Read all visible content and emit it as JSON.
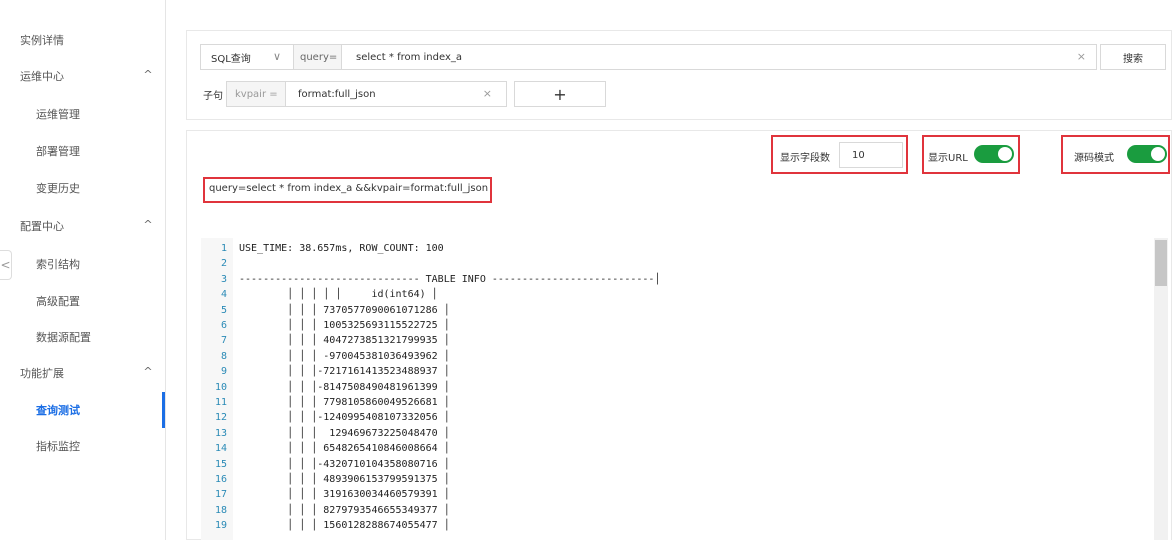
{
  "sidebar": {
    "items": [
      {
        "label": "实例详情",
        "level": "top"
      },
      {
        "label": "运维中心",
        "level": "top",
        "chevron": "^"
      },
      {
        "label": "运维管理",
        "level": "sub"
      },
      {
        "label": "部署管理",
        "level": "sub"
      },
      {
        "label": "变更历史",
        "level": "sub"
      },
      {
        "label": "配置中心",
        "level": "top",
        "chevron": "^"
      },
      {
        "label": "索引结构",
        "level": "sub"
      },
      {
        "label": "高级配置",
        "level": "sub"
      },
      {
        "label": "数据源配置",
        "level": "sub"
      },
      {
        "label": "功能扩展",
        "level": "top",
        "chevron": "^"
      },
      {
        "label": "查询测试",
        "level": "sub",
        "active": true
      },
      {
        "label": "指标监控",
        "level": "sub"
      }
    ],
    "collapse_glyph": "<"
  },
  "query": {
    "type_select": "SQL查询",
    "type_caret": "∨",
    "query_prefix": "query=",
    "query_value": "select * from   index_a",
    "clear_glyph": "×",
    "search_label": "搜索"
  },
  "clause": {
    "label": "子句",
    "key_select": "kvpair =",
    "value": "format:full_json",
    "clear_glyph": "×",
    "add_glyph": "+"
  },
  "options": {
    "field_count_label": "显示字段数",
    "field_count_value": "10",
    "show_url_label": "显示URL",
    "show_url_on": true,
    "source_mode_label": "源码模式",
    "source_mode_on": true
  },
  "url_text": "query=select * from index_a &&kvpair=format:full_json",
  "code_lines": [
    {
      "n": "1",
      "t": "USE_TIME: 38.657ms, ROW_COUNT: 100"
    },
    {
      "n": "2",
      "t": ""
    },
    {
      "n": "3",
      "t": "------------------------------ TABLE INFO ---------------------------│"
    },
    {
      "n": "4",
      "t": "        │ │ │ │ │     id(int64) │"
    },
    {
      "n": "5",
      "t": "        │ │ │ 7370577090061071286 │"
    },
    {
      "n": "6",
      "t": "        │ │ │ 1005325693115522725 │"
    },
    {
      "n": "7",
      "t": "        │ │ │ 4047273851321799935 │"
    },
    {
      "n": "8",
      "t": "        │ │ │ -970045381036493962 │"
    },
    {
      "n": "9",
      "t": "        │ │ │-7217161413523488937 │"
    },
    {
      "n": "10",
      "t": "        │ │ │-8147508490481961399 │"
    },
    {
      "n": "11",
      "t": "        │ │ │ 7798105860049526681 │"
    },
    {
      "n": "12",
      "t": "        │ │ │-1240995408107332056 │"
    },
    {
      "n": "13",
      "t": "        │ │ │  129469673225048470 │"
    },
    {
      "n": "14",
      "t": "        │ │ │ 6548265410846008664 │"
    },
    {
      "n": "15",
      "t": "        │ │ │-4320710104358080716 │"
    },
    {
      "n": "16",
      "t": "        │ │ │ 4893906153799591375 │"
    },
    {
      "n": "17",
      "t": "        │ │ │ 3191630034460579391 │"
    },
    {
      "n": "18",
      "t": "        │ │ │ 8279793546655349377 │"
    },
    {
      "n": "19",
      "t": "        │ │ │ 1560128288674055477 │"
    }
  ],
  "colors": {
    "accent": "#1b6ee5",
    "toggle_on": "#1a9c3f",
    "highlight": "#e0343c",
    "line_number": "#2a8ab6"
  }
}
